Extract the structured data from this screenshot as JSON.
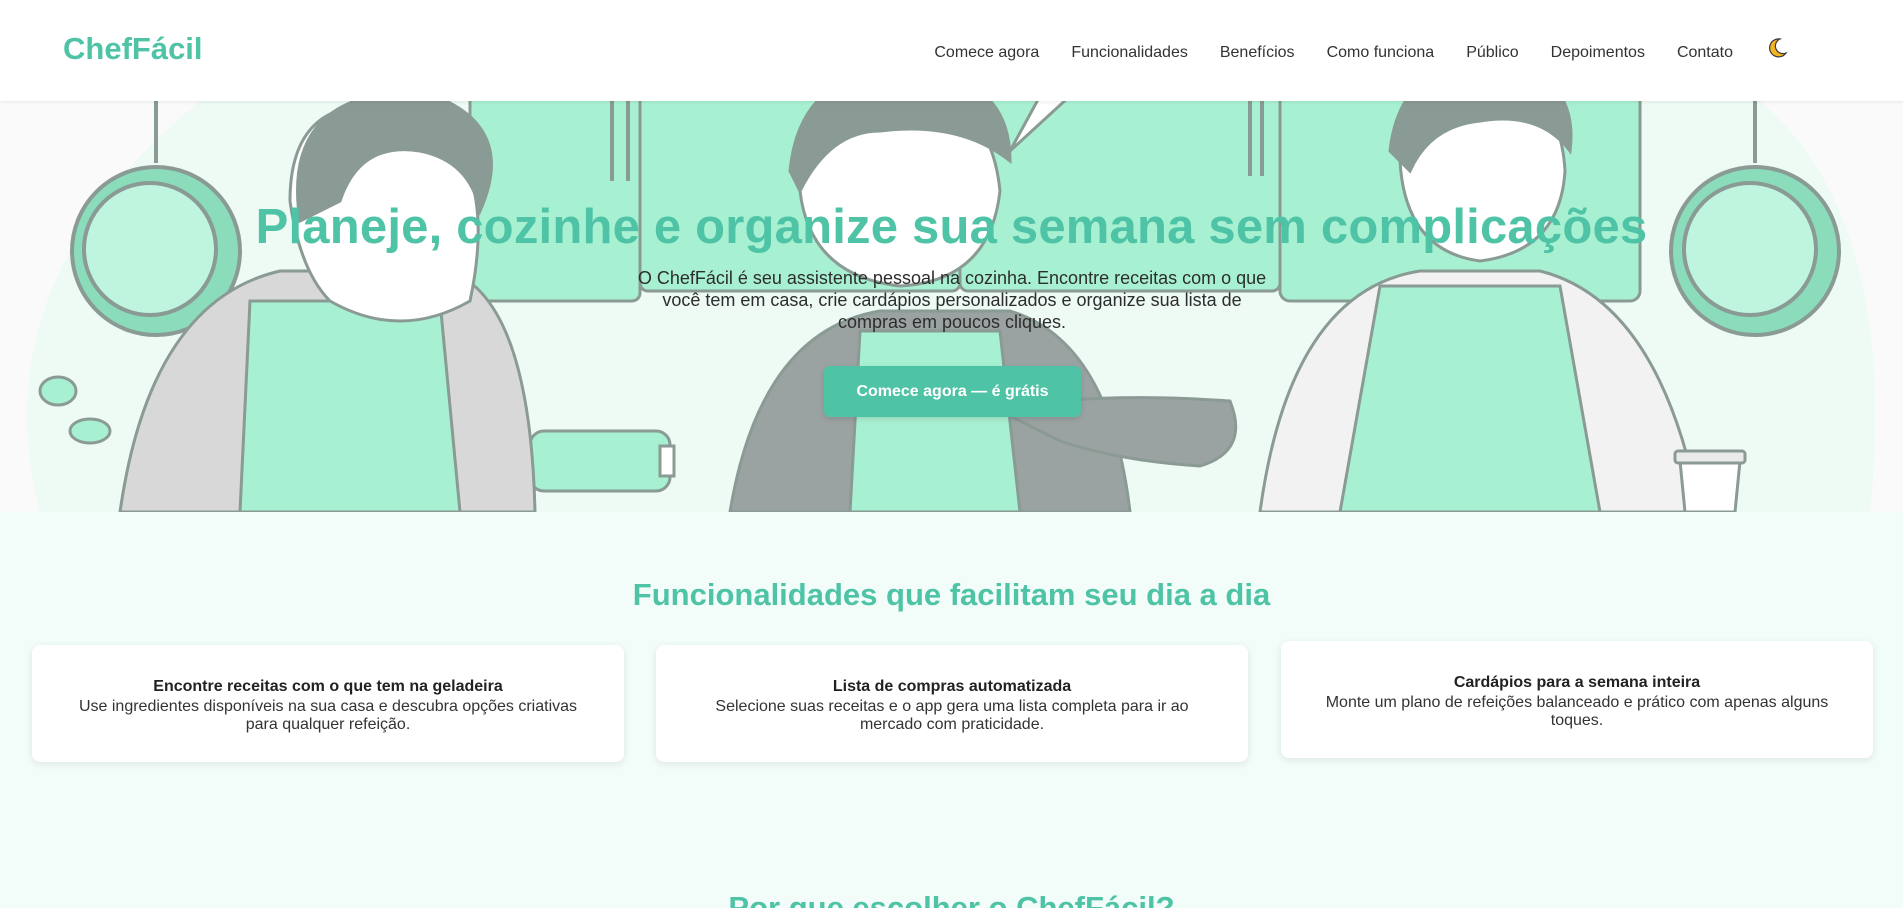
{
  "brand": {
    "name": "ChefFácil",
    "color": "#4fc3a6"
  },
  "nav": {
    "items": [
      "Comece agora",
      "Funcionalidades",
      "Benefícios",
      "Como funciona",
      "Público",
      "Depoimentos",
      "Contato"
    ],
    "theme_toggle_icon": "moon-icon"
  },
  "hero": {
    "title": "Planeje, cozinhe e organize sua semana sem complicações",
    "subtitle": "O ChefFácil é seu assistente pessoal na cozinha. Encontre receitas com o que você tem em casa, crie cardápios personalizados e organize sua lista de compras em poucos cliques.",
    "cta": "Comece agora — é grátis"
  },
  "features": {
    "title": "Funcionalidades que facilitam seu dia a dia",
    "cards": [
      {
        "title": "Encontre receitas com o que tem na geladeira",
        "text": "Use ingredientes disponíveis na sua casa e descubra opções criativas para qualquer refeição."
      },
      {
        "title": "Lista de compras automatizada",
        "text": "Selecione suas receitas e o app gera uma lista completa para ir ao mercado com praticidade."
      },
      {
        "title": "Cardápios para a semana inteira",
        "text": "Monte um plano de refeições balanceado e prático com apenas alguns toques."
      }
    ]
  },
  "why": {
    "title": "Por que escolher o ChefFácil?"
  }
}
